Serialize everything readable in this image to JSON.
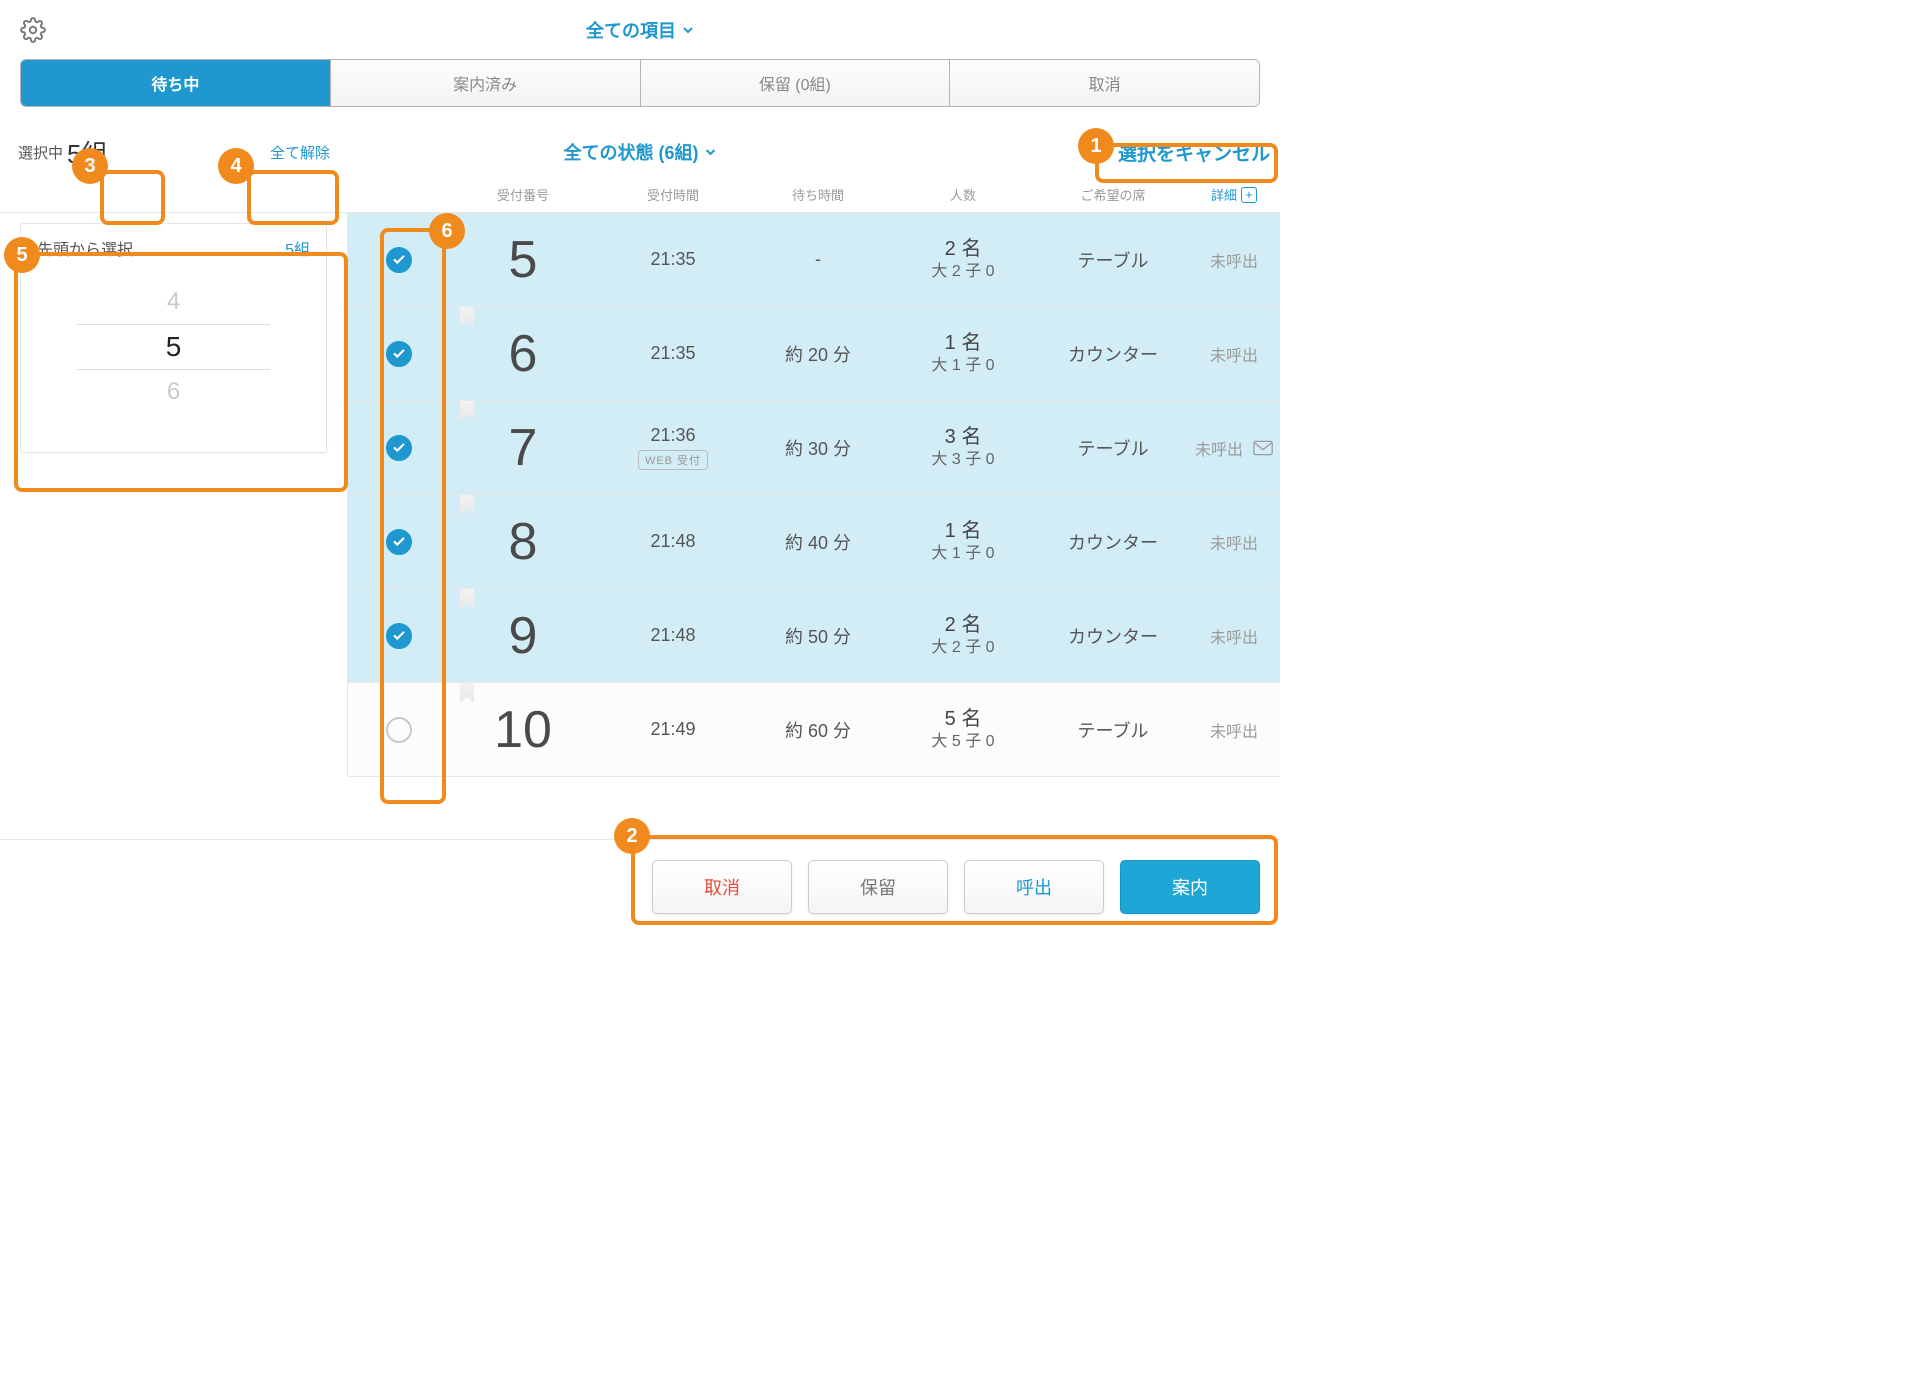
{
  "header": {
    "title": "全ての項目"
  },
  "tabs": {
    "waiting": "待ち中",
    "done": "案内済み",
    "hold": "保留 (0組)",
    "cancel": "取消"
  },
  "subheader": {
    "selecting_label": "選択中",
    "selecting_count": "5組",
    "clear_all": "全て解除",
    "status_filter": "全ての状態 (6組)",
    "cancel_selection": "選択をキャンセル"
  },
  "side": {
    "title": "先頭から選択",
    "value": "5組",
    "options": [
      "4",
      "5",
      "6"
    ]
  },
  "columns": {
    "number": "受付番号",
    "time": "受付時間",
    "wait": "待ち時間",
    "people": "人数",
    "seat": "ご希望の席",
    "detail": "詳細"
  },
  "rows": [
    {
      "selected": true,
      "num": "5",
      "time": "21:35",
      "web": false,
      "wait": "-",
      "p1": "2 名",
      "p2": "大 2 子 0",
      "seat": "テーブル",
      "status": "未呼出",
      "mail": false,
      "bookmark": false
    },
    {
      "selected": true,
      "num": "6",
      "time": "21:35",
      "web": false,
      "wait": "約 20 分",
      "p1": "1 名",
      "p2": "大 1 子 0",
      "seat": "カウンター",
      "status": "未呼出",
      "mail": false,
      "bookmark": true
    },
    {
      "selected": true,
      "num": "7",
      "time": "21:36",
      "web": true,
      "wait": "約 30 分",
      "p1": "3 名",
      "p2": "大 3 子 0",
      "seat": "テーブル",
      "status": "未呼出",
      "mail": true,
      "bookmark": true
    },
    {
      "selected": true,
      "num": "8",
      "time": "21:48",
      "web": false,
      "wait": "約 40 分",
      "p1": "1 名",
      "p2": "大 1 子 0",
      "seat": "カウンター",
      "status": "未呼出",
      "mail": false,
      "bookmark": true
    },
    {
      "selected": true,
      "num": "9",
      "time": "21:48",
      "web": false,
      "wait": "約 50 分",
      "p1": "2 名",
      "p2": "大 2 子 0",
      "seat": "カウンター",
      "status": "未呼出",
      "mail": false,
      "bookmark": true
    },
    {
      "selected": false,
      "num": "10",
      "time": "21:49",
      "web": false,
      "wait": "約 60 分",
      "p1": "5 名",
      "p2": "大 5 子 0",
      "seat": "テーブル",
      "status": "未呼出",
      "mail": false,
      "bookmark": true
    }
  ],
  "web_label": "WEB 受付",
  "actions": {
    "cancel": "取消",
    "hold": "保留",
    "call": "呼出",
    "guide": "案内"
  },
  "annotations": [
    "1",
    "2",
    "3",
    "4",
    "5",
    "6"
  ]
}
